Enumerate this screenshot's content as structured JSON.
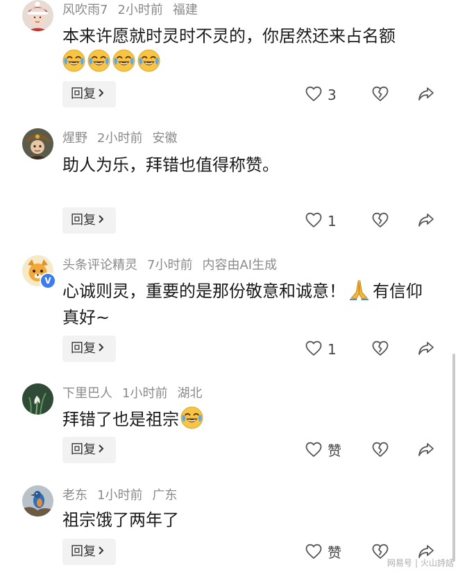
{
  "comments": [
    {
      "user": "风吹雨7",
      "time": "2小时前",
      "location": "福建",
      "text": "本来许愿就时灵时不灵的，你居然还来占名额",
      "emoji_line": [
        "laugh-cry-emoji",
        "laugh-cry-emoji",
        "laugh-cry-emoji",
        "laugh-cry-emoji"
      ],
      "reply_label": "回复",
      "like_count": "3"
    },
    {
      "user": "煋野",
      "time": "2小时前",
      "location": "安徽",
      "text": "助人为乐，拜错也值得称赞。",
      "reply_label": "回复",
      "like_count": "1"
    },
    {
      "user": "头条评论精灵",
      "time": "7小时前",
      "location": "内容由AI生成",
      "text_part1": "心诚则灵，重要的是那份敬意和诚意！",
      "text_part2": "有信仰真好~",
      "inline_emoji": "praying-hands-emoji",
      "verified_badge": "V",
      "reply_label": "回复",
      "like_count": "1"
    },
    {
      "user": "下里巴人",
      "time": "1小时前",
      "location": "湖北",
      "text": "拜错了也是祖宗",
      "inline_emoji": "laugh-cry-emoji",
      "reply_label": "回复",
      "like_count": "赞"
    },
    {
      "user": "老东",
      "time": "1小时前",
      "location": "广东",
      "text": "祖宗饿了两年了",
      "reply_label": "回复",
      "like_count": "赞"
    }
  ],
  "watermark": {
    "left": "网易号",
    "right": "火山詩話"
  },
  "icons": {
    "like": "heart-outline-icon",
    "dislike": "broken-heart-icon",
    "share": "share-arrow-icon",
    "reply_chevron": "chevron-right-icon"
  },
  "colors": {
    "meta_text": "#8a8a8a",
    "body_text": "#1a1a1a",
    "reply_bg": "#f2f2f2",
    "icon": "#555555",
    "verified_badge": "#3b7cf0"
  }
}
